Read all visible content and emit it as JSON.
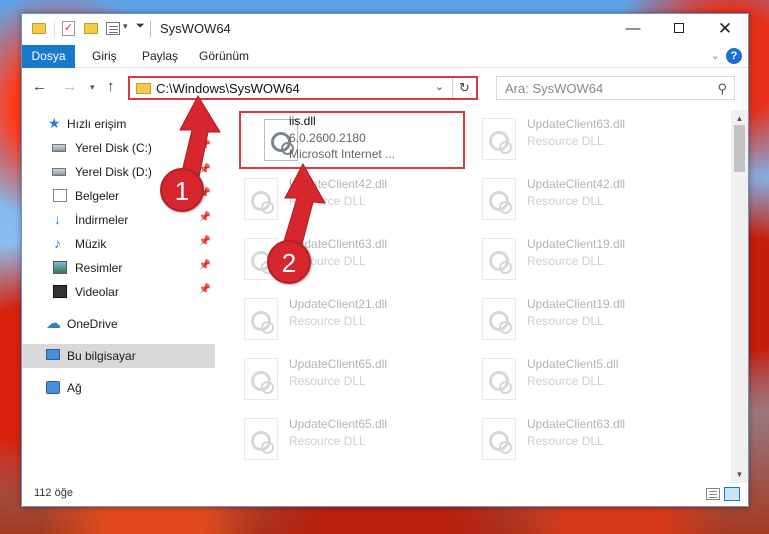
{
  "window": {
    "title": "SysWOW64"
  },
  "ribbon": {
    "file_tab": "Dosya",
    "tabs": [
      "Giriş",
      "Paylaş",
      "Görünüm"
    ],
    "help": "?"
  },
  "nav": {
    "address": "C:\\Windows\\SysWOW64",
    "search_placeholder": "Ara: SysWOW64"
  },
  "sidebar": {
    "items": [
      {
        "label": "Hızlı erişim",
        "icon": "star-icon"
      },
      {
        "label": "Yerel Disk (C:)",
        "icon": "drive-icon",
        "pinned": true
      },
      {
        "label": "Yerel Disk (D:)",
        "icon": "drive-icon",
        "pinned": true
      },
      {
        "label": "Belgeler",
        "icon": "documents-icon",
        "pinned": true
      },
      {
        "label": "İndirmeler",
        "icon": "downloads-icon",
        "pinned": true
      },
      {
        "label": "Müzik",
        "icon": "music-icon",
        "pinned": true
      },
      {
        "label": "Resimler",
        "icon": "pictures-icon",
        "pinned": true
      },
      {
        "label": "Videolar",
        "icon": "videos-icon",
        "pinned": true
      },
      {
        "label": "OneDrive",
        "icon": "cloud-icon"
      },
      {
        "label": "Bu bilgisayar",
        "icon": "computer-icon",
        "selected": true
      },
      {
        "label": "Ağ",
        "icon": "network-icon"
      }
    ]
  },
  "files": [
    {
      "name": "iis.dll",
      "line2": "6.0.2600.2180",
      "line3": "Microsoft Internet ...",
      "highlighted": true
    },
    {
      "name": "UpdateClient63.dll",
      "line2": "Resource DLL"
    },
    {
      "name": "UpdateClient42.dll",
      "line2": "Resource DLL"
    },
    {
      "name": "UpdateClient42.dll",
      "line2": "Resource DLL"
    },
    {
      "name": "UpdateClient63.dll",
      "line2": "Resource DLL"
    },
    {
      "name": "UpdateClient19.dll",
      "line2": "Resource DLL"
    },
    {
      "name": "UpdateClient21.dll",
      "line2": "Resource DLL"
    },
    {
      "name": "UpdateClient19.dll",
      "line2": "Resource DLL"
    },
    {
      "name": "UpdateClient65.dll",
      "line2": "Resource DLL"
    },
    {
      "name": "UpdateClient5.dll",
      "line2": "Resource DLL"
    },
    {
      "name": "UpdateClient65.dll",
      "line2": "Resource DLL"
    },
    {
      "name": "UpdateClient63.dll",
      "line2": "Resource DLL"
    }
  ],
  "status": {
    "item_count": "112 öğe"
  },
  "annotations": {
    "badge1": "1",
    "badge2": "2",
    "color": "#d8262e"
  },
  "colors": {
    "accent": "#1979ca",
    "highlight": "#d63b3b",
    "folder": "#f3c94e"
  }
}
